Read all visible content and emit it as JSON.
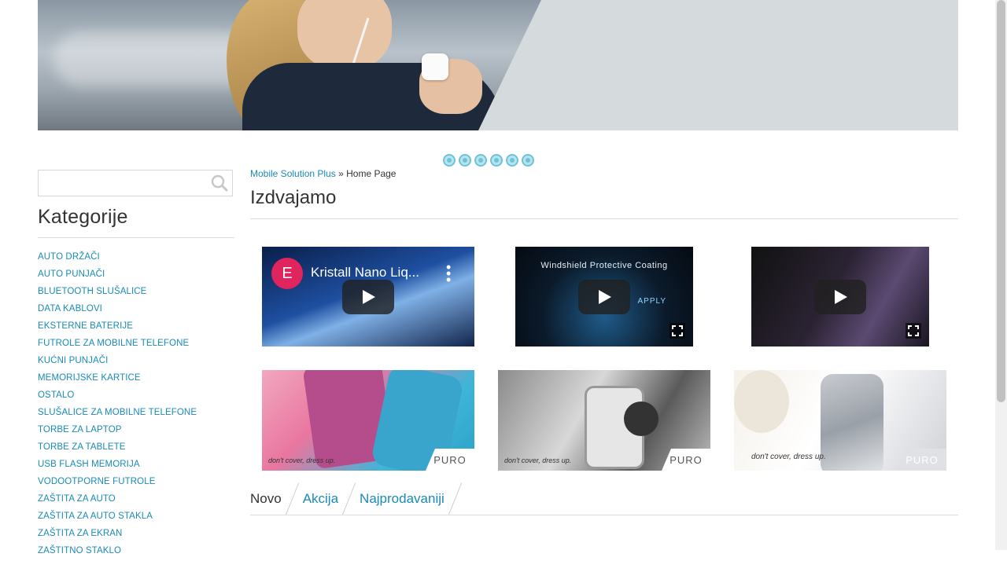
{
  "search": {
    "placeholder": ""
  },
  "sidebar": {
    "title": "Kategorije",
    "categories": [
      "AUTO DRŽAČI",
      "AUTO PUNJAČI",
      "BLUETOOTH SLUŠALICE",
      "DATA KABLOVI",
      "EKSTERNE BATERIJE",
      "FUTROLE ZA MOBILNE TELEFONE",
      "KUĆNI PUNJAČI",
      "MEMORIJSKE KARTICE",
      "OSTALO",
      "SLUŠALICE ZA MOBILNE TELEFONE",
      "TORBE ZA LAPTOP",
      "TORBE ZA TABLETE",
      "USB FLASH MEMORIJA",
      "VODOOTPORNE FUTROLE",
      "ZAŠTITA ZA AUTO",
      "ZAŠTITA ZA AUTO STAKLA",
      "ZAŠTITA ZA EKRAN",
      "ZAŠTITNO STAKLO"
    ]
  },
  "breadcrumb": {
    "home_link": "Mobile Solution Plus",
    "separator": "»",
    "current": "Home Page"
  },
  "featured": {
    "title": "Izdvajamo",
    "videos": [
      {
        "channel_initial": "E",
        "title": "Kristall Nano Liq...",
        "caption": "",
        "sub": ""
      },
      {
        "channel_initial": "",
        "title": "",
        "caption": "Windshield Protective Coating",
        "sub": "APPLY"
      },
      {
        "channel_initial": "",
        "title": "",
        "caption": "",
        "sub": ""
      }
    ],
    "promos": [
      {
        "tagline": "don't cover, dress up.",
        "brand": "PURO"
      },
      {
        "tagline": "don't cover, dress up.",
        "brand": "PURO"
      },
      {
        "tagline": "don't cover, dress up.",
        "brand": "PURO"
      }
    ]
  },
  "tabs": [
    {
      "label": "Novo",
      "active": true
    },
    {
      "label": "Akcija",
      "active": false
    },
    {
      "label": "Najprodavaniji",
      "active": false
    }
  ],
  "slider": {
    "dot_count": 6
  },
  "colors": {
    "link": "#1a8ab8",
    "accent_dot": "#6fc3d8",
    "text": "#333333"
  }
}
